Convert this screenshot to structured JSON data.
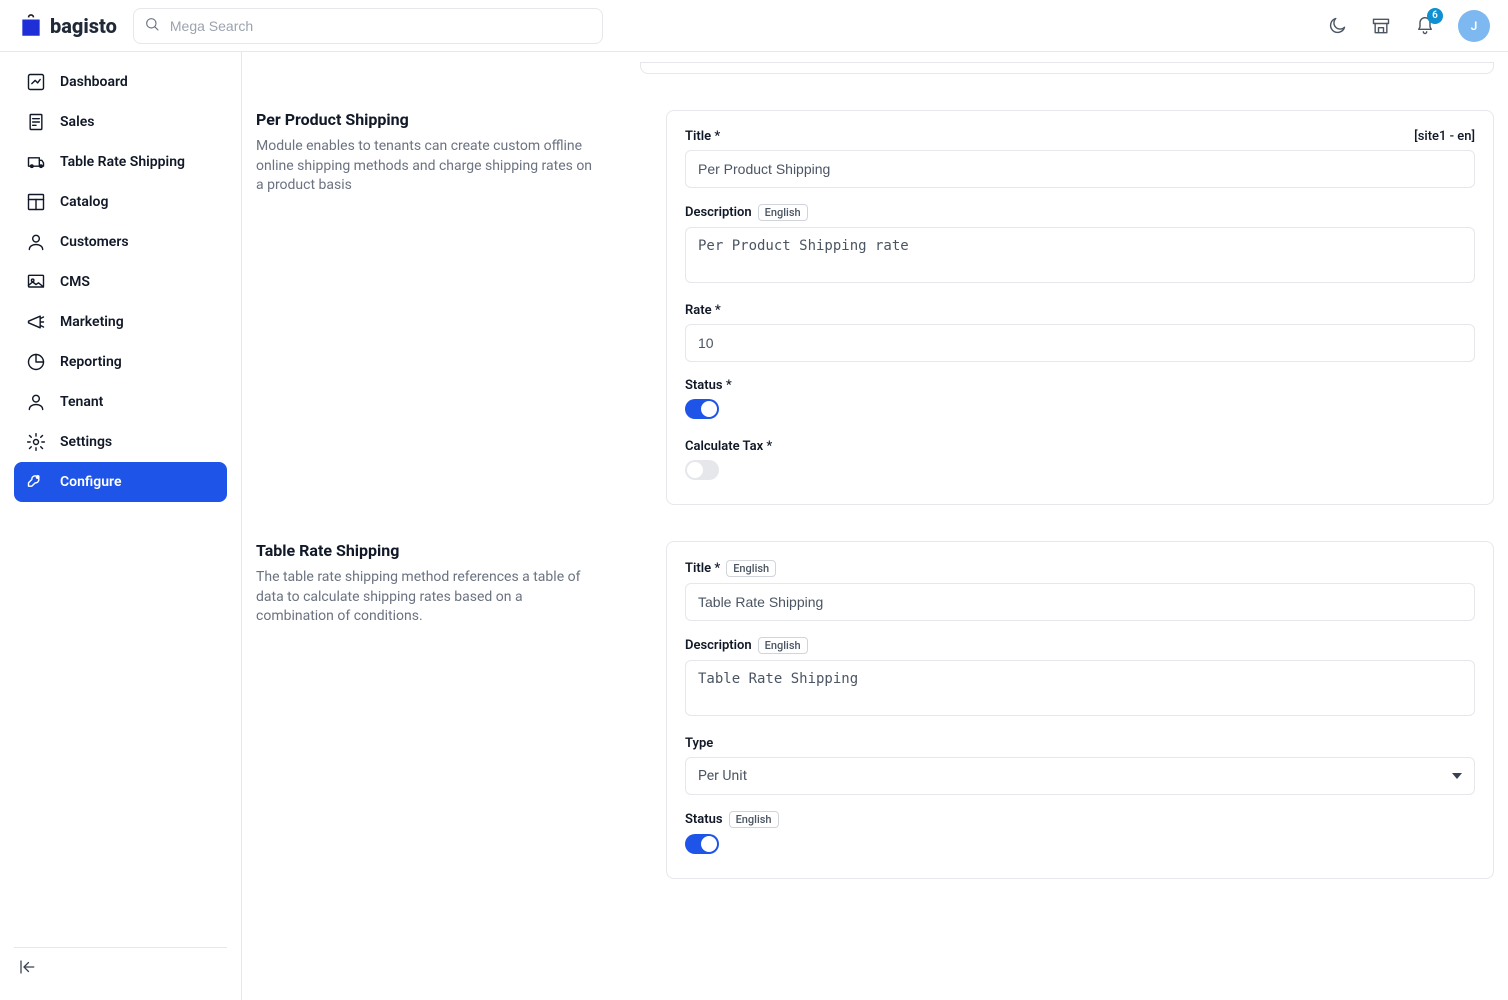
{
  "brand": {
    "name": "bagisto",
    "avatar_initial": "J"
  },
  "search": {
    "placeholder": "Mega Search"
  },
  "notifications": {
    "count": "6"
  },
  "sidebar": {
    "items": [
      {
        "label": "Dashboard"
      },
      {
        "label": "Sales"
      },
      {
        "label": "Table Rate Shipping"
      },
      {
        "label": "Catalog"
      },
      {
        "label": "Customers"
      },
      {
        "label": "CMS"
      },
      {
        "label": "Marketing"
      },
      {
        "label": "Reporting"
      },
      {
        "label": "Tenant"
      },
      {
        "label": "Settings"
      },
      {
        "label": "Configure"
      }
    ]
  },
  "sections": {
    "per_product": {
      "title": "Per Product Shipping",
      "desc": "Module enables to tenants can create custom offline online shipping methods and charge shipping rates on a product basis",
      "locale_hint": "[site1 - en]",
      "labels": {
        "title": "Title",
        "description": "Description",
        "rate": "Rate",
        "status": "Status",
        "calc_tax": "Calculate Tax"
      },
      "values": {
        "title": "Per Product Shipping",
        "description": "Per Product Shipping rate",
        "rate": "10",
        "status": true,
        "calc_tax": false
      },
      "lang_tag": "English"
    },
    "table_rate": {
      "title": "Table Rate Shipping",
      "desc": "The table rate shipping method references a table of data to calculate shipping rates based on a combination of conditions.",
      "labels": {
        "title": "Title",
        "description": "Description",
        "type": "Type",
        "status": "Status"
      },
      "values": {
        "title": "Table Rate Shipping",
        "description": "Table Rate Shipping",
        "type": "Per Unit",
        "status": true
      },
      "lang_tag": "English"
    }
  }
}
